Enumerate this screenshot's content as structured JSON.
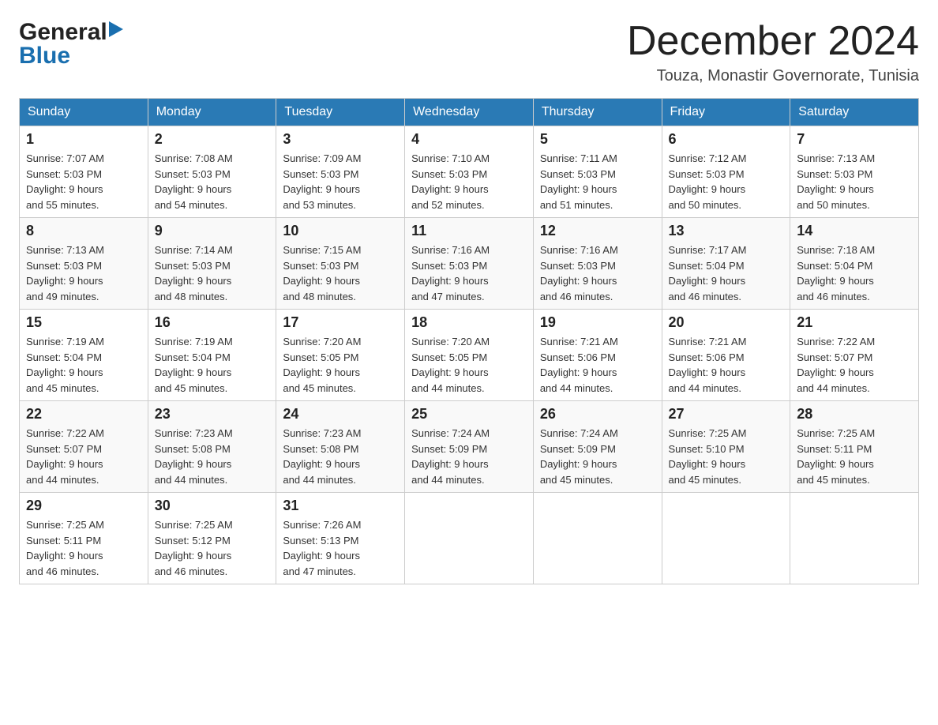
{
  "logo": {
    "general": "General",
    "blue": "Blue"
  },
  "header": {
    "month": "December 2024",
    "location": "Touza, Monastir Governorate, Tunisia"
  },
  "weekdays": [
    "Sunday",
    "Monday",
    "Tuesday",
    "Wednesday",
    "Thursday",
    "Friday",
    "Saturday"
  ],
  "weeks": [
    [
      {
        "day": "1",
        "sunrise": "7:07 AM",
        "sunset": "5:03 PM",
        "daylight": "9 hours and 55 minutes."
      },
      {
        "day": "2",
        "sunrise": "7:08 AM",
        "sunset": "5:03 PM",
        "daylight": "9 hours and 54 minutes."
      },
      {
        "day": "3",
        "sunrise": "7:09 AM",
        "sunset": "5:03 PM",
        "daylight": "9 hours and 53 minutes."
      },
      {
        "day": "4",
        "sunrise": "7:10 AM",
        "sunset": "5:03 PM",
        "daylight": "9 hours and 52 minutes."
      },
      {
        "day": "5",
        "sunrise": "7:11 AM",
        "sunset": "5:03 PM",
        "daylight": "9 hours and 51 minutes."
      },
      {
        "day": "6",
        "sunrise": "7:12 AM",
        "sunset": "5:03 PM",
        "daylight": "9 hours and 50 minutes."
      },
      {
        "day": "7",
        "sunrise": "7:13 AM",
        "sunset": "5:03 PM",
        "daylight": "9 hours and 50 minutes."
      }
    ],
    [
      {
        "day": "8",
        "sunrise": "7:13 AM",
        "sunset": "5:03 PM",
        "daylight": "9 hours and 49 minutes."
      },
      {
        "day": "9",
        "sunrise": "7:14 AM",
        "sunset": "5:03 PM",
        "daylight": "9 hours and 48 minutes."
      },
      {
        "day": "10",
        "sunrise": "7:15 AM",
        "sunset": "5:03 PM",
        "daylight": "9 hours and 48 minutes."
      },
      {
        "day": "11",
        "sunrise": "7:16 AM",
        "sunset": "5:03 PM",
        "daylight": "9 hours and 47 minutes."
      },
      {
        "day": "12",
        "sunrise": "7:16 AM",
        "sunset": "5:03 PM",
        "daylight": "9 hours and 46 minutes."
      },
      {
        "day": "13",
        "sunrise": "7:17 AM",
        "sunset": "5:04 PM",
        "daylight": "9 hours and 46 minutes."
      },
      {
        "day": "14",
        "sunrise": "7:18 AM",
        "sunset": "5:04 PM",
        "daylight": "9 hours and 46 minutes."
      }
    ],
    [
      {
        "day": "15",
        "sunrise": "7:19 AM",
        "sunset": "5:04 PM",
        "daylight": "9 hours and 45 minutes."
      },
      {
        "day": "16",
        "sunrise": "7:19 AM",
        "sunset": "5:04 PM",
        "daylight": "9 hours and 45 minutes."
      },
      {
        "day": "17",
        "sunrise": "7:20 AM",
        "sunset": "5:05 PM",
        "daylight": "9 hours and 45 minutes."
      },
      {
        "day": "18",
        "sunrise": "7:20 AM",
        "sunset": "5:05 PM",
        "daylight": "9 hours and 44 minutes."
      },
      {
        "day": "19",
        "sunrise": "7:21 AM",
        "sunset": "5:06 PM",
        "daylight": "9 hours and 44 minutes."
      },
      {
        "day": "20",
        "sunrise": "7:21 AM",
        "sunset": "5:06 PM",
        "daylight": "9 hours and 44 minutes."
      },
      {
        "day": "21",
        "sunrise": "7:22 AM",
        "sunset": "5:07 PM",
        "daylight": "9 hours and 44 minutes."
      }
    ],
    [
      {
        "day": "22",
        "sunrise": "7:22 AM",
        "sunset": "5:07 PM",
        "daylight": "9 hours and 44 minutes."
      },
      {
        "day": "23",
        "sunrise": "7:23 AM",
        "sunset": "5:08 PM",
        "daylight": "9 hours and 44 minutes."
      },
      {
        "day": "24",
        "sunrise": "7:23 AM",
        "sunset": "5:08 PM",
        "daylight": "9 hours and 44 minutes."
      },
      {
        "day": "25",
        "sunrise": "7:24 AM",
        "sunset": "5:09 PM",
        "daylight": "9 hours and 44 minutes."
      },
      {
        "day": "26",
        "sunrise": "7:24 AM",
        "sunset": "5:09 PM",
        "daylight": "9 hours and 45 minutes."
      },
      {
        "day": "27",
        "sunrise": "7:25 AM",
        "sunset": "5:10 PM",
        "daylight": "9 hours and 45 minutes."
      },
      {
        "day": "28",
        "sunrise": "7:25 AM",
        "sunset": "5:11 PM",
        "daylight": "9 hours and 45 minutes."
      }
    ],
    [
      {
        "day": "29",
        "sunrise": "7:25 AM",
        "sunset": "5:11 PM",
        "daylight": "9 hours and 46 minutes."
      },
      {
        "day": "30",
        "sunrise": "7:25 AM",
        "sunset": "5:12 PM",
        "daylight": "9 hours and 46 minutes."
      },
      {
        "day": "31",
        "sunrise": "7:26 AM",
        "sunset": "5:13 PM",
        "daylight": "9 hours and 47 minutes."
      },
      null,
      null,
      null,
      null
    ]
  ],
  "labels": {
    "sunrise": "Sunrise:",
    "sunset": "Sunset:",
    "daylight": "Daylight:"
  }
}
